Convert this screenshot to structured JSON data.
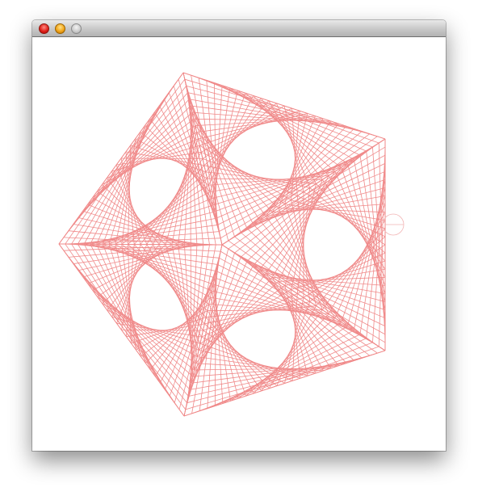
{
  "window": {
    "title": "",
    "buttons": {
      "close": "close-button",
      "minimize": "minimize-button",
      "zoom": "zoom-button"
    }
  },
  "drawing": {
    "line_color": "#f08a8a",
    "cursor_color": "#f2b5b5",
    "star_points": 5,
    "subdivisions": 26
  }
}
